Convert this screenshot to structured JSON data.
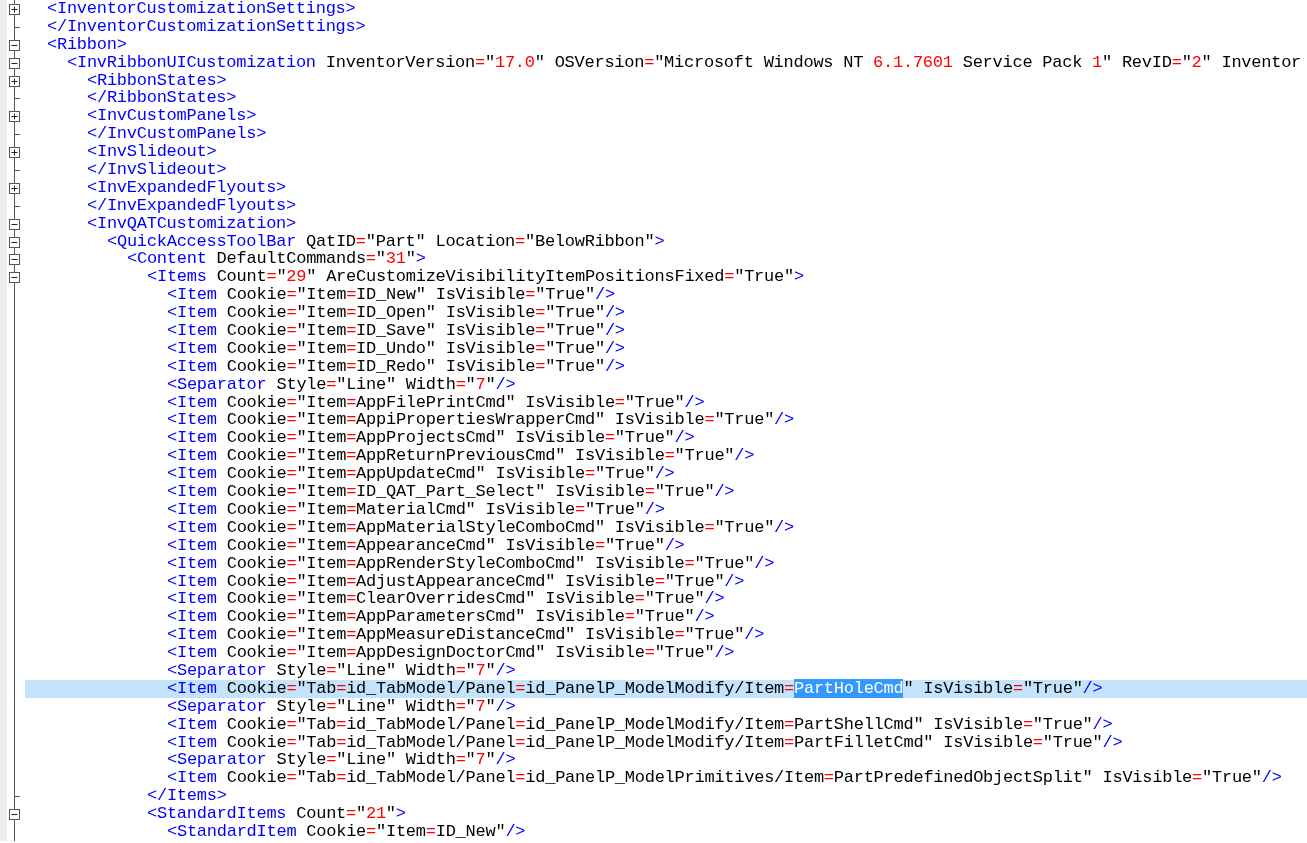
{
  "editor": {
    "lines": [
      {
        "text": "<InventorCustomizationSettings>",
        "kind": "fold_start",
        "expanded": false,
        "selected": false
      },
      {
        "text": "</InventorCustomizationSettings>",
        "kind": "fold_end",
        "selected": false
      },
      {
        "text": "<Ribbon>",
        "kind": "fold_start",
        "expanded": true,
        "selected": false,
        "children": [
          {
            "text": "<InvRibbonUICustomization InventorVersion=\"17.0\" OSVersion=\"Microsoft Windows NT 6.1.7601 Service Pack 1\" RevID=\"2\" Inventor",
            "kind": "fold_start",
            "expanded": true,
            "selected": false,
            "children": [
              {
                "text": "<RibbonStates>",
                "kind": "fold_start",
                "expanded": false,
                "selected": false
              },
              {
                "text": "</RibbonStates>",
                "kind": "fold_end",
                "selected": false
              },
              {
                "text": "<InvCustomPanels>",
                "kind": "fold_start",
                "expanded": false,
                "selected": false
              },
              {
                "text": "</InvCustomPanels>",
                "kind": "fold_end",
                "selected": false
              },
              {
                "text": "<InvSlideout>",
                "kind": "fold_start",
                "expanded": false,
                "selected": false
              },
              {
                "text": "</InvSlideout>",
                "kind": "fold_end",
                "selected": false
              },
              {
                "text": "<InvExpandedFlyouts>",
                "kind": "fold_start",
                "expanded": false,
                "selected": false
              },
              {
                "text": "</InvExpandedFlyouts>",
                "kind": "fold_end",
                "selected": false
              },
              {
                "text": "<InvQATCustomization>",
                "kind": "fold_start",
                "expanded": true,
                "selected": false,
                "children": [
                  {
                    "text": "<QuickAccessToolBar QatID=\"Part\" Location=\"BelowRibbon\">",
                    "kind": "fold_start",
                    "expanded": true,
                    "selected": false,
                    "children": [
                      {
                        "text": "<Content DefaultCommands=\"31\">",
                        "kind": "fold_start",
                        "expanded": true,
                        "selected": false,
                        "children": [
                          {
                            "text": "<Items Count=\"29\" AreCustomizeVisibilityItemPositionsFixed=\"True\">",
                            "kind": "fold_start",
                            "expanded": true,
                            "selected": false,
                            "children": [
                              {
                                "text": "<Item Cookie=\"Item=ID_New\" IsVisible=\"True\"/>",
                                "kind": "plain",
                                "selected": false
                              },
                              {
                                "text": "<Item Cookie=\"Item=ID_Open\" IsVisible=\"True\"/>",
                                "kind": "plain",
                                "selected": false
                              },
                              {
                                "text": "<Item Cookie=\"Item=ID_Save\" IsVisible=\"True\"/>",
                                "kind": "plain",
                                "selected": false
                              },
                              {
                                "text": "<Item Cookie=\"Item=ID_Undo\" IsVisible=\"True\"/>",
                                "kind": "plain",
                                "selected": false
                              },
                              {
                                "text": "<Item Cookie=\"Item=ID_Redo\" IsVisible=\"True\"/>",
                                "kind": "plain",
                                "selected": false
                              },
                              {
                                "text": "<Separator Style=\"Line\" Width=\"7\"/>",
                                "kind": "plain",
                                "selected": false
                              },
                              {
                                "text": "<Item Cookie=\"Item=AppFilePrintCmd\" IsVisible=\"True\"/>",
                                "kind": "plain",
                                "selected": false
                              },
                              {
                                "text": "<Item Cookie=\"Item=AppiPropertiesWrapperCmd\" IsVisible=\"True\"/>",
                                "kind": "plain",
                                "selected": false
                              },
                              {
                                "text": "<Item Cookie=\"Item=AppProjectsCmd\" IsVisible=\"True\"/>",
                                "kind": "plain",
                                "selected": false
                              },
                              {
                                "text": "<Item Cookie=\"Item=AppReturnPreviousCmd\" IsVisible=\"True\"/>",
                                "kind": "plain",
                                "selected": false
                              },
                              {
                                "text": "<Item Cookie=\"Item=AppUpdateCmd\" IsVisible=\"True\"/>",
                                "kind": "plain",
                                "selected": false
                              },
                              {
                                "text": "<Item Cookie=\"Item=ID_QAT_Part_Select\" IsVisible=\"True\"/>",
                                "kind": "plain",
                                "selected": false
                              },
                              {
                                "text": "<Item Cookie=\"Item=MaterialCmd\" IsVisible=\"True\"/>",
                                "kind": "plain",
                                "selected": false
                              },
                              {
                                "text": "<Item Cookie=\"Item=AppMaterialStyleComboCmd\" IsVisible=\"True\"/>",
                                "kind": "plain",
                                "selected": false
                              },
                              {
                                "text": "<Item Cookie=\"Item=AppearanceCmd\" IsVisible=\"True\"/>",
                                "kind": "plain",
                                "selected": false
                              },
                              {
                                "text": "<Item Cookie=\"Item=AppRenderStyleComboCmd\" IsVisible=\"True\"/>",
                                "kind": "plain",
                                "selected": false
                              },
                              {
                                "text": "<Item Cookie=\"Item=AdjustAppearanceCmd\" IsVisible=\"True\"/>",
                                "kind": "plain",
                                "selected": false
                              },
                              {
                                "text": "<Item Cookie=\"Item=ClearOverridesCmd\" IsVisible=\"True\"/>",
                                "kind": "plain",
                                "selected": false
                              },
                              {
                                "text": "<Item Cookie=\"Item=AppParametersCmd\" IsVisible=\"True\"/>",
                                "kind": "plain",
                                "selected": false
                              },
                              {
                                "text": "<Item Cookie=\"Item=AppMeasureDistanceCmd\" IsVisible=\"True\"/>",
                                "kind": "plain",
                                "selected": false
                              },
                              {
                                "text": "<Item Cookie=\"Item=AppDesignDoctorCmd\" IsVisible=\"True\"/>",
                                "kind": "plain",
                                "selected": false
                              },
                              {
                                "text": "<Separator Style=\"Line\" Width=\"7\"/>",
                                "kind": "plain",
                                "selected": false
                              },
                              {
                                "text": "<Item Cookie=\"Tab=id_TabModel/Panel=id_PanelP_ModelModify/Item=",
                                "selected_text": "PartHoleCmd",
                                "text_after": "\" IsVisible=\"True\"/>",
                                "kind": "plain",
                                "selected": true
                              },
                              {
                                "text": "<Separator Style=\"Line\" Width=\"7\"/>",
                                "kind": "plain",
                                "selected": false
                              },
                              {
                                "text": "<Item Cookie=\"Tab=id_TabModel/Panel=id_PanelP_ModelModify/Item=PartShellCmd\" IsVisible=\"True\"/>",
                                "kind": "plain",
                                "selected": false
                              },
                              {
                                "text": "<Item Cookie=\"Tab=id_TabModel/Panel=id_PanelP_ModelModify/Item=PartFilletCmd\" IsVisible=\"True\"/>",
                                "kind": "plain",
                                "selected": false
                              },
                              {
                                "text": "<Separator Style=\"Line\" Width=\"7\"/>",
                                "kind": "plain",
                                "selected": false
                              },
                              {
                                "text": "<Item Cookie=\"Tab=id_TabModel/Panel=id_PanelP_ModelPrimitives/Item=PartPredefinedObjectSplit\" IsVisible=\"True\"/>",
                                "kind": "plain",
                                "selected": false
                              }
                            ]
                          },
                          {
                            "text": "</Items>",
                            "kind": "fold_end",
                            "selected": false
                          },
                          {
                            "text": "<StandardItems Count=\"21\">",
                            "kind": "fold_start",
                            "expanded": true,
                            "selected": false,
                            "children": [
                              {
                                "text": "<StandardItem Cookie=\"Item=ID_New\"/>",
                                "kind": "plain",
                                "selected": false
                              }
                            ]
                          }
                        ]
                      }
                    ]
                  }
                ]
              }
            ]
          }
        ]
      }
    ]
  }
}
